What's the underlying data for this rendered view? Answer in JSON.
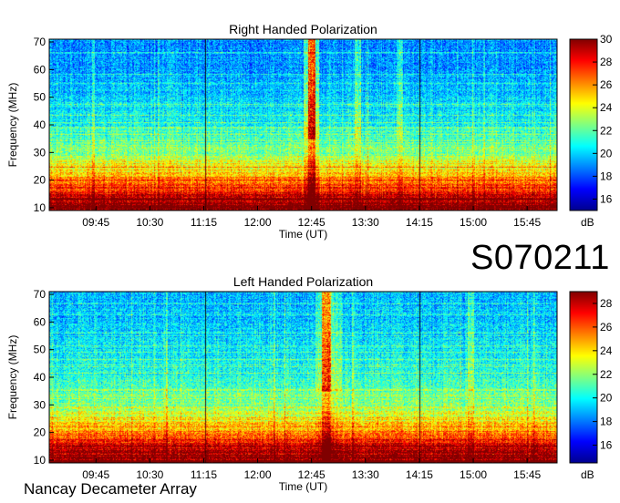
{
  "observation_id": "S070211",
  "footer": "Nancay Decameter Array",
  "colors": {
    "colormap": [
      "#00008f",
      "#0000ff",
      "#0080ff",
      "#00ffff",
      "#80ff80",
      "#ffff00",
      "#ff8000",
      "#ff0000",
      "#800000"
    ]
  },
  "chart_data": [
    {
      "type": "heatmap",
      "title": "Right Handed Polarization",
      "xlabel": "Time (UT)",
      "ylabel": "Frequency (MHz)",
      "x_ticks": [
        "09:45",
        "10:30",
        "11:15",
        "12:00",
        "12:45",
        "13:30",
        "14:15",
        "15:00",
        "15:45"
      ],
      "x_tick_minutes": [
        585,
        630,
        675,
        720,
        765,
        810,
        855,
        900,
        945
      ],
      "xlim_minutes": [
        546,
        970
      ],
      "y_ticks": [
        10,
        20,
        30,
        40,
        50,
        60,
        70
      ],
      "ylim": [
        9,
        71
      ],
      "colorbar": {
        "label": "dB",
        "ticks": [
          16,
          18,
          20,
          22,
          24,
          26,
          28,
          30
        ],
        "range": [
          15,
          30
        ]
      },
      "profile": [
        [
          10,
          30
        ],
        [
          15,
          28.5
        ],
        [
          20,
          26.5
        ],
        [
          25,
          24.3
        ],
        [
          30,
          22.8
        ],
        [
          35,
          21.8
        ],
        [
          40,
          20.8
        ],
        [
          50,
          20.0
        ],
        [
          60,
          19.2
        ],
        [
          71,
          19.0
        ]
      ],
      "bursts": [
        {
          "start": 762,
          "end": 768,
          "boost": 6.5
        },
        {
          "start": 758,
          "end": 771,
          "boost": 3.0
        },
        {
          "start": 801,
          "end": 806,
          "boost": 2.5
        },
        {
          "start": 836,
          "end": 841,
          "boost": 2.2
        }
      ],
      "dark_lines": [
        676,
        855
      ]
    },
    {
      "type": "heatmap",
      "title": "Left Handed Polarization",
      "xlabel": "Time (UT)",
      "ylabel": "Frequency (MHz)",
      "x_ticks": [
        "09:45",
        "10:30",
        "11:15",
        "12:00",
        "12:45",
        "13:30",
        "14:15",
        "15:00",
        "15:45"
      ],
      "x_tick_minutes": [
        585,
        630,
        675,
        720,
        765,
        810,
        855,
        900,
        945
      ],
      "xlim_minutes": [
        546,
        970
      ],
      "y_ticks": [
        10,
        20,
        30,
        40,
        50,
        60,
        70
      ],
      "ylim": [
        9,
        71
      ],
      "colorbar": {
        "label": "dB",
        "ticks": [
          16,
          18,
          20,
          22,
          24,
          26,
          28
        ],
        "range": [
          14.5,
          29
        ]
      },
      "profile": [
        [
          10,
          29
        ],
        [
          15,
          28
        ],
        [
          20,
          25.5
        ],
        [
          25,
          23.5
        ],
        [
          30,
          22.2
        ],
        [
          35,
          21.3
        ],
        [
          40,
          20.5
        ],
        [
          50,
          19.8
        ],
        [
          60,
          19.2
        ],
        [
          71,
          19.0
        ]
      ],
      "bursts": [
        {
          "start": 773,
          "end": 781,
          "boost": 5.5
        },
        {
          "start": 768,
          "end": 790,
          "boost": 2.0
        },
        {
          "start": 895,
          "end": 900,
          "boost": 1.8
        }
      ],
      "dark_lines": [
        676,
        855
      ]
    }
  ]
}
